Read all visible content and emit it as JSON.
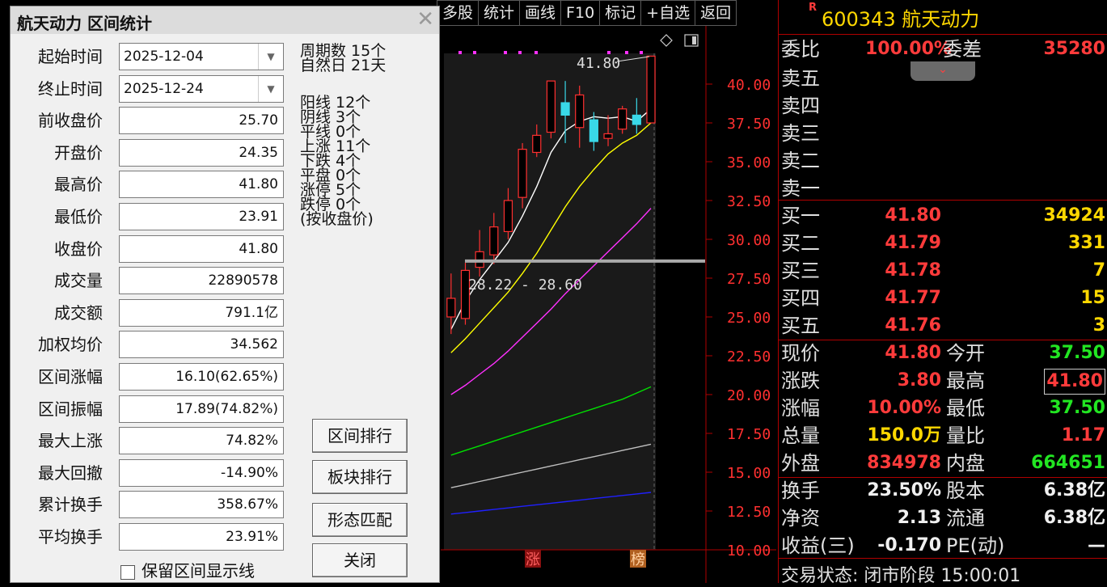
{
  "toolbar": {
    "items": [
      "多股",
      "统计",
      "画线",
      "F10",
      "标记",
      "+自选",
      "返回"
    ]
  },
  "stock": {
    "mark": "R",
    "code": "600343",
    "name": "航天动力"
  },
  "quote": {
    "weibi_label": "委比",
    "weibi_value": "100.00%",
    "weicha_label": "委差",
    "weicha_value": "35280",
    "sell": [
      {
        "label": "卖五",
        "price": "",
        "vol": ""
      },
      {
        "label": "卖四",
        "price": "",
        "vol": ""
      },
      {
        "label": "卖三",
        "price": "",
        "vol": ""
      },
      {
        "label": "卖二",
        "price": "",
        "vol": ""
      },
      {
        "label": "卖一",
        "price": "",
        "vol": ""
      }
    ],
    "buy": [
      {
        "label": "买一",
        "price": "41.80",
        "vol": "34924"
      },
      {
        "label": "买二",
        "price": "41.79",
        "vol": "331"
      },
      {
        "label": "买三",
        "price": "41.78",
        "vol": "7"
      },
      {
        "label": "买四",
        "price": "41.77",
        "vol": "15"
      },
      {
        "label": "买五",
        "price": "41.76",
        "vol": "3"
      }
    ],
    "stats": [
      {
        "l1": "现价",
        "v1": "41.80",
        "c1": "red",
        "l2": "今开",
        "v2": "37.50",
        "c2": "green"
      },
      {
        "l1": "涨跌",
        "v1": "3.80",
        "c1": "red",
        "l2": "最高",
        "v2": "41.80",
        "c2": "red"
      },
      {
        "l1": "涨幅",
        "v1": "10.00%",
        "c1": "red",
        "l2": "最低",
        "v2": "37.50",
        "c2": "green"
      },
      {
        "l1": "总量",
        "v1": "150.0万",
        "c1": "yellow",
        "l2": "量比",
        "v2": "1.17",
        "c2": "red"
      },
      {
        "l1": "外盘",
        "v1": "834978",
        "c1": "red",
        "l2": "内盘",
        "v2": "664651",
        "c2": "green"
      }
    ],
    "stats2": [
      {
        "l1": "换手",
        "v1": "23.50%",
        "l2": "股本",
        "v2": "6.38亿"
      },
      {
        "l1": "净资",
        "v1": "2.13",
        "l2": "流通",
        "v2": "6.38亿"
      },
      {
        "l1": "收益(三)",
        "v1": "-0.170",
        "l2": "PE(动)",
        "v2": "—"
      }
    ],
    "trade_status": "交易状态: 闭市阶段 15:00:01"
  },
  "chart": {
    "high_label": "41.80",
    "range_label": "28.22 - 28.60",
    "y_ticks": [
      "40.00",
      "37.50",
      "35.00",
      "32.50",
      "30.00",
      "27.50",
      "25.00",
      "22.50",
      "20.00",
      "17.50",
      "15.00",
      "12.50",
      "10.00"
    ],
    "bottom_tags": [
      "涨",
      "榜"
    ],
    "colors": {
      "up": "#ff3030",
      "down": "#39d8e8",
      "ma5": "#ffffff",
      "ma10": "#ffff00",
      "ma20": "#ff30ff",
      "ma60": "#00e000",
      "ma120": "#c0c0c0",
      "ma250": "#2020ff"
    }
  },
  "chart_data": {
    "type": "candlestick",
    "title": "",
    "y_ticks": [
      40.0,
      37.5,
      35.0,
      32.5,
      30.0,
      27.5,
      25.0,
      22.5,
      20.0,
      17.5,
      15.0,
      12.5,
      10.0
    ],
    "ylim": [
      9.5,
      43.0
    ],
    "candles": [
      {
        "o": 25.0,
        "h": 27.8,
        "l": 23.9,
        "c": 26.2
      },
      {
        "o": 24.9,
        "h": 28.5,
        "l": 24.5,
        "c": 28.0
      },
      {
        "o": 28.2,
        "h": 30.6,
        "l": 27.6,
        "c": 29.2
      },
      {
        "o": 29.0,
        "h": 31.7,
        "l": 28.4,
        "c": 30.8
      },
      {
        "o": 30.5,
        "h": 33.3,
        "l": 30.0,
        "c": 32.5
      },
      {
        "o": 32.7,
        "h": 36.2,
        "l": 32.0,
        "c": 35.8
      },
      {
        "o": 35.6,
        "h": 37.4,
        "l": 35.3,
        "c": 36.7
      },
      {
        "o": 36.9,
        "h": 40.2,
        "l": 36.5,
        "c": 40.2
      },
      {
        "o": 38.8,
        "h": 40.2,
        "l": 36.2,
        "c": 38.0
      },
      {
        "o": 37.2,
        "h": 39.9,
        "l": 35.9,
        "c": 39.3
      },
      {
        "o": 37.7,
        "h": 38.2,
        "l": 35.7,
        "c": 36.3
      },
      {
        "o": 36.5,
        "h": 38.0,
        "l": 36.0,
        "c": 36.8
      },
      {
        "o": 37.1,
        "h": 38.6,
        "l": 36.8,
        "c": 38.4
      },
      {
        "o": 38.0,
        "h": 39.1,
        "l": 36.8,
        "c": 37.4
      },
      {
        "o": 37.5,
        "h": 41.8,
        "l": 37.5,
        "c": 41.8
      }
    ],
    "ma5": [
      24.2,
      26.0,
      27.4,
      28.6,
      29.8,
      31.5,
      33.4,
      35.6,
      37.0,
      37.6,
      37.9,
      37.8,
      37.9,
      37.6,
      38.4
    ],
    "ma10": [
      22.7,
      23.6,
      24.6,
      25.6,
      26.6,
      27.8,
      29.1,
      30.6,
      32.1,
      33.4,
      34.5,
      35.5,
      36.2,
      36.7,
      37.5
    ],
    "ma20": [
      20.0,
      20.6,
      21.3,
      22.0,
      22.8,
      23.7,
      24.6,
      25.5,
      26.5,
      27.4,
      28.3,
      29.2,
      30.1,
      31.0,
      32.0
    ],
    "ma60": [
      16.1,
      16.4,
      16.7,
      17.0,
      17.3,
      17.6,
      17.9,
      18.2,
      18.5,
      18.8,
      19.1,
      19.4,
      19.7,
      20.1,
      20.5
    ],
    "ma120": [
      14.0,
      14.2,
      14.4,
      14.6,
      14.8,
      15.0,
      15.2,
      15.4,
      15.6,
      15.8,
      16.0,
      16.2,
      16.4,
      16.6,
      16.8
    ],
    "ma250": [
      12.3,
      12.4,
      12.5,
      12.6,
      12.7,
      12.8,
      12.9,
      13.0,
      13.1,
      13.2,
      13.3,
      13.4,
      13.5,
      13.6,
      13.7
    ],
    "range_line": [
      28.22,
      28.6
    ]
  },
  "dialog": {
    "title": "航天动力 区间统计",
    "fields": [
      {
        "label": "起始时间",
        "value": "2025-12-04",
        "combo": true
      },
      {
        "label": "终止时间",
        "value": "2025-12-24",
        "combo": true
      },
      {
        "label": "前收盘价",
        "value": "25.70"
      },
      {
        "label": "开盘价",
        "value": "24.35"
      },
      {
        "label": "最高价",
        "value": "41.80"
      },
      {
        "label": "最低价",
        "value": "23.91"
      },
      {
        "label": "收盘价",
        "value": "41.80"
      },
      {
        "label": "成交量",
        "value": "22890578"
      },
      {
        "label": "成交额",
        "value": "791.1亿"
      },
      {
        "label": "加权均价",
        "value": "34.562"
      },
      {
        "label": "区间涨幅",
        "value": "16.10(62.65%)"
      },
      {
        "label": "区间振幅",
        "value": "17.89(74.82%)"
      },
      {
        "label": "最大上涨",
        "value": "74.82%"
      },
      {
        "label": "最大回撤",
        "value": "-14.90%"
      },
      {
        "label": "累计换手",
        "value": "358.67%"
      },
      {
        "label": "平均换手",
        "value": "23.91%"
      }
    ],
    "stats": [
      "周期数 15个",
      "自然日 21天",
      "阳线 12个",
      "阴线 3个",
      "平线 0个",
      "上涨 11个",
      "下跌 4个",
      "平盘 0个",
      "涨停 5个",
      "跌停 0个",
      "(按收盘价)"
    ],
    "buttons": [
      "区间排行",
      "板块排行",
      "形态匹配",
      "关闭"
    ],
    "keep_line_label": "保留区间显示线"
  }
}
